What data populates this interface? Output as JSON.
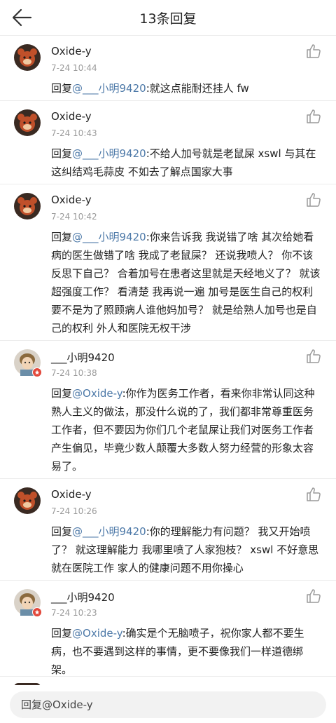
{
  "header": {
    "title": "13条回复"
  },
  "comments": [
    {
      "user": "Oxide-y",
      "time": "7-24 10:44",
      "reply_prefix": "回复",
      "mention": "@___小明9420",
      "text": ":就这点能耐还挂人 fw"
    },
    {
      "user": "Oxide-y",
      "time": "7-24 10:43",
      "reply_prefix": "回复",
      "mention": "@___小明9420",
      "text": ":不给人加号就是老鼠屎 xswl 与其在这纠结鸡毛蒜皮 不如去了解点国家大事"
    },
    {
      "user": "Oxide-y",
      "time": "7-24 10:42",
      "reply_prefix": "回复",
      "mention": "@___小明9420",
      "text": ":你来告诉我 我说错了啥 其次给她看病的医生做错了啥 我成了老鼠屎？ 还说我喷人？ 你不该反思下自己？ 合着加号在患者这里就是天经地义了？ 就该超强度工作？ 看清楚 我再说一遍 加号是医生自己的权利 要不是为了照顾病人谁他妈加号？ 就是给熟人加号也是自己的权利 外人和医院无权干涉"
    },
    {
      "user": "___小明9420",
      "time": "7-24 10:38",
      "reply_prefix": "回复",
      "mention": "@Oxide-y",
      "text": ":你作为医务工作者，看来你非常认同这种熟人主义的做法，那没什么说的了，我们都非常尊重医务工作者，但不要因为你们几个老鼠屎让我们对医务工作者产生偏见，毕竟少数人颠覆大多数人努力经营的形象太容易了。"
    },
    {
      "user": "Oxide-y",
      "time": "7-24 10:26",
      "reply_prefix": "回复",
      "mention": "@___小明9420",
      "text": ":你的理解能力有问题？ 我又开始喷了？ 就这理解能力 我哪里喷了人家狍枝？ xswl 不好意思 就在医院工作 家人的健康问题不用你操心"
    },
    {
      "user": "___小明9420",
      "time": "7-24 10:23",
      "reply_prefix": "回复",
      "mention": "@Oxide-y",
      "text": ":确实是个无脑喷子，祝你家人都不要生病，也不要遇到这样的事情，更不要像我们一样道德绑架。"
    }
  ],
  "reply_bar": {
    "value": "回复@Oxide-y"
  },
  "colors": {
    "mention": "#4d79a8",
    "divider": "#ececec",
    "time": "#9a9a9a"
  }
}
